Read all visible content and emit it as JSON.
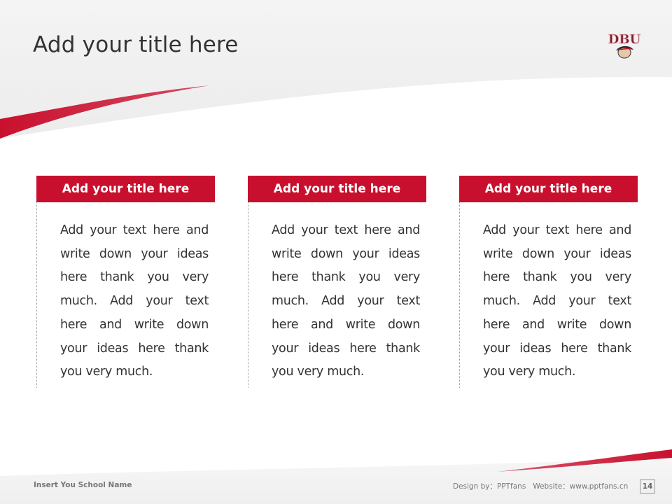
{
  "header": {
    "title": "Add your title here",
    "logo": {
      "text": "DBU",
      "icon": "mascot-logo-icon"
    }
  },
  "colors": {
    "accent": "#c8102e",
    "text": "#333333",
    "muted": "#777777"
  },
  "cards": [
    {
      "title": "Add your title here",
      "body": "Add your text here and write down your ideas here thank you very much. Add your text here and write down your ideas here thank you very much."
    },
    {
      "title": "Add your title here",
      "body": "Add your text here and write down your ideas here thank you very much. Add your text here and write down your ideas here thank you very much."
    },
    {
      "title": "Add your title here",
      "body": "Add your text here and write down your ideas here thank you very much. Add your text here and write down your ideas here thank you very much."
    }
  ],
  "footer": {
    "school_name": "Insert You School Name",
    "credit": "Design by：PPTfans   Website：www.pptfans.cn",
    "page_number": "14"
  }
}
